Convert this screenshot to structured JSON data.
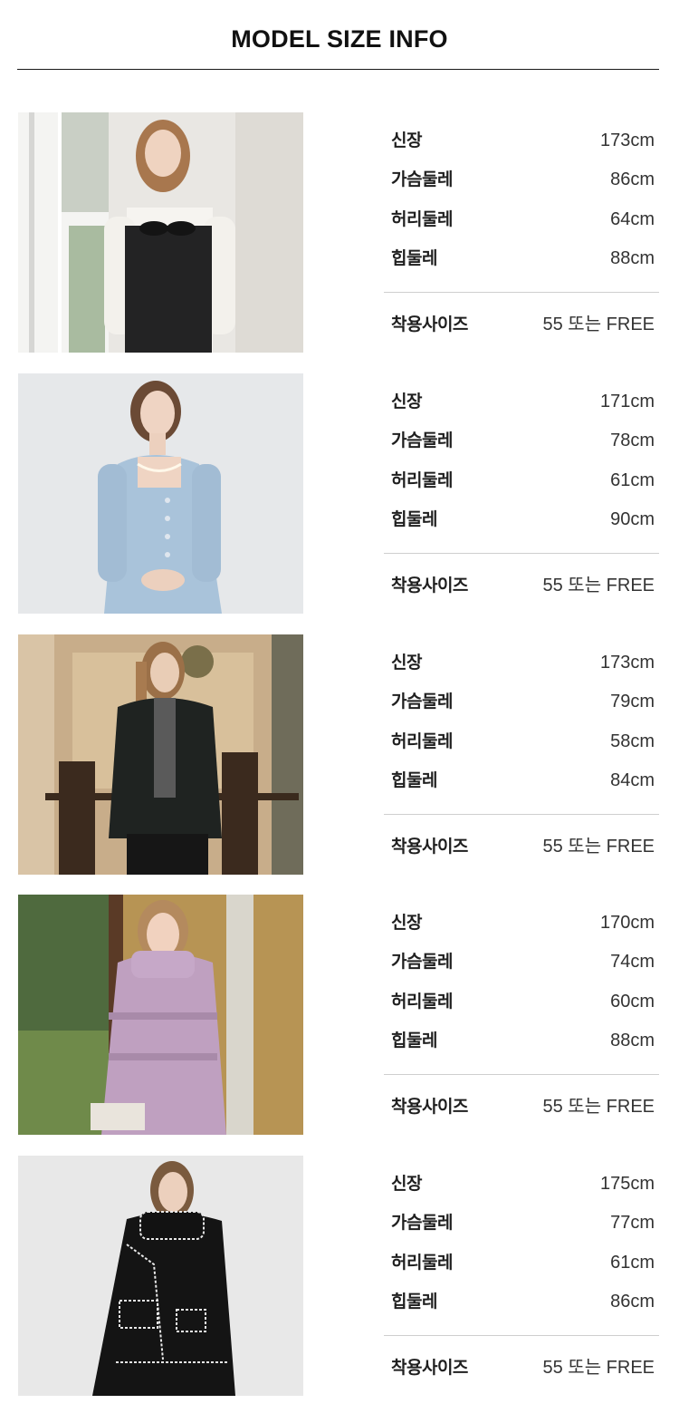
{
  "header": {
    "title": "MODEL SIZE INFO"
  },
  "labels": {
    "height": "신장",
    "bust": "가슴둘레",
    "waist": "허리둘레",
    "hip": "힙둘레",
    "fit_size": "착용사이즈"
  },
  "models": [
    {
      "photo": "model-photo-white-blouse-black-dress",
      "height": "173cm",
      "bust": "86cm",
      "waist": "64cm",
      "hip": "88cm",
      "fit_size": "55 또는 FREE"
    },
    {
      "photo": "model-photo-blue-tweed-jacket",
      "height": "171cm",
      "bust": "78cm",
      "waist": "61cm",
      "hip": "90cm",
      "fit_size": "55 또는 FREE"
    },
    {
      "photo": "model-photo-black-leather-jacket",
      "height": "173cm",
      "bust": "79cm",
      "waist": "58cm",
      "hip": "84cm",
      "fit_size": "55 또는 FREE"
    },
    {
      "photo": "model-photo-lilac-puffer-jacket",
      "height": "170cm",
      "bust": "74cm",
      "waist": "60cm",
      "hip": "88cm",
      "fit_size": "55 또는 FREE"
    },
    {
      "photo": "model-photo-black-wool-coat-scarf",
      "height": "175cm",
      "bust": "77cm",
      "waist": "61cm",
      "hip": "86cm",
      "fit_size": "55 또는 FREE"
    }
  ]
}
